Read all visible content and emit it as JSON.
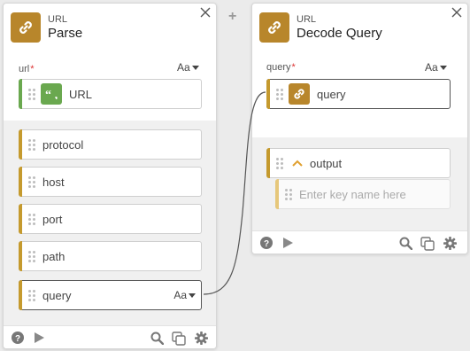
{
  "add_button": "+",
  "card1": {
    "app": "URL",
    "name": "Parse",
    "input_label": "url",
    "input_required": "*",
    "aa": "Aa",
    "input_value": "URL",
    "outputs": [
      {
        "label": "protocol"
      },
      {
        "label": "host"
      },
      {
        "label": "port"
      },
      {
        "label": "path"
      },
      {
        "label": "query",
        "aa": "Aa"
      }
    ]
  },
  "card2": {
    "app": "URL",
    "name": "Decode Query",
    "input_label": "query",
    "input_required": "*",
    "aa": "Aa",
    "input_value": "query",
    "output_label": "output",
    "key_placeholder": "Enter key name here"
  },
  "icons": {
    "module": "link-icon",
    "string": "quote-icon",
    "help": "question-icon",
    "run": "play-icon",
    "search": "search-icon",
    "copy": "copy-icon",
    "settings": "gear-icon",
    "close": "close-icon",
    "expand": "chevron-up-icon"
  },
  "colors": {
    "module_gold": "#b8862b",
    "string_green": "#6aa84f",
    "stripe": "#c59a2e",
    "wire": "#555555"
  }
}
